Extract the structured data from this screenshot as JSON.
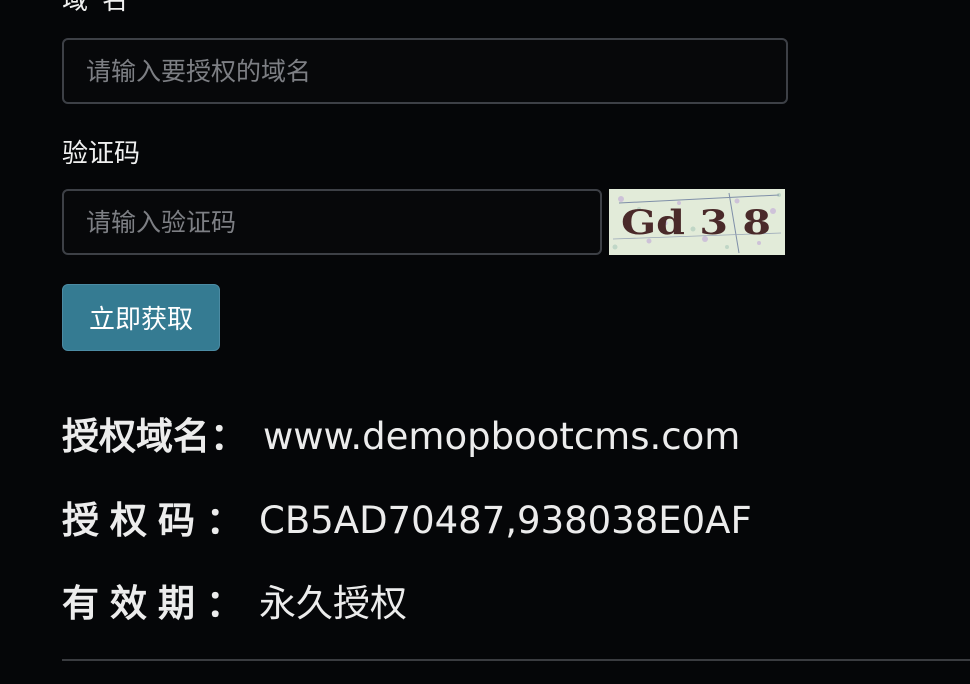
{
  "form": {
    "domain_label": "域名",
    "domain_placeholder": "请输入要授权的域名",
    "domain_value": "",
    "captcha_label": "验证码",
    "captcha_placeholder": "请输入验证码",
    "captcha_value": "",
    "captcha_text": "Gd 3 8",
    "submit_label": "立即获取"
  },
  "result": {
    "domain_key": "授权域名",
    "domain_value": "www.demopbootcms.com",
    "code_key": "授权码",
    "code_value": "CB5AD70487,938038E0AF",
    "validity_key": "有效期",
    "validity_value": "永久授权",
    "separator": "："
  },
  "colors": {
    "background": "#050608",
    "button": "#357b92",
    "input_border": "#3d4046"
  }
}
